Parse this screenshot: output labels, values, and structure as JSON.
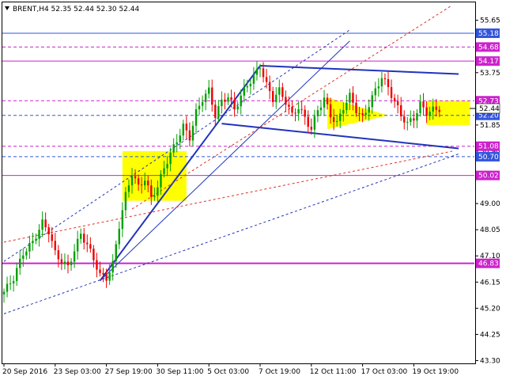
{
  "chart_data": {
    "type": "candlestick",
    "title": "BRENT,H4  52.35 52.44 52.30 52.44",
    "symbol": "BRENT",
    "timeframe": "H4",
    "last_bar": {
      "open": 52.35,
      "high": 52.44,
      "low": 52.3,
      "close": 52.44
    },
    "current_price_label": "52.44",
    "ylim": [
      43.2,
      56.3
    ],
    "y_ticks": [
      "55.65",
      "54.68",
      "53.75",
      "52.80",
      "51.85",
      "50.90",
      "50.02",
      "49.00",
      "48.05",
      "47.10",
      "46.15",
      "45.20",
      "44.25",
      "43.30"
    ],
    "x_ticks": [
      "20 Sep 2016",
      "23 Sep 03:00",
      "27 Sep 19:00",
      "30 Sep 11:00",
      "5 Oct 03:00",
      "7 Oct 19:00",
      "12 Oct 11:00",
      "17 Oct 03:00",
      "19 Oct 19:00"
    ],
    "x_tick_index": [
      0,
      16,
      32,
      48,
      64,
      80,
      96,
      112,
      128
    ],
    "bar_count": 142,
    "level_labels": [
      {
        "text": "55.18",
        "price": 55.18,
        "color": "#3355dd"
      },
      {
        "text": "54.68",
        "price": 54.68,
        "color": "#cc22cc"
      },
      {
        "text": "54.17",
        "price": 54.17,
        "color": "#cc22cc"
      },
      {
        "text": "52.73",
        "price": 52.73,
        "color": "#cc22cc"
      },
      {
        "text": "52.20",
        "price": 52.2,
        "color": "#3355dd"
      },
      {
        "text": "51.08",
        "price": 51.08,
        "color": "#cc22cc"
      },
      {
        "text": "50.70",
        "price": 50.7,
        "color": "#3355dd"
      },
      {
        "text": "50.02",
        "price": 50.02,
        "color": "#cc22cc"
      },
      {
        "text": "46.83",
        "price": 46.83,
        "color": "#cc22cc"
      }
    ],
    "close_path": [
      [
        0,
        45.8
      ],
      [
        3,
        46.3
      ],
      [
        6,
        47.2
      ],
      [
        9,
        47.6
      ],
      [
        12,
        48.3
      ],
      [
        14,
        48.0
      ],
      [
        16,
        47.2
      ],
      [
        18,
        46.9
      ],
      [
        20,
        46.7
      ],
      [
        22,
        47.3
      ],
      [
        24,
        47.9
      ],
      [
        26,
        47.5
      ],
      [
        28,
        47.0
      ],
      [
        30,
        46.4
      ],
      [
        32,
        46.3
      ],
      [
        34,
        46.8
      ],
      [
        36,
        48.2
      ],
      [
        38,
        49.3
      ],
      [
        40,
        50.1
      ],
      [
        42,
        49.6
      ],
      [
        44,
        49.9
      ],
      [
        46,
        49.2
      ],
      [
        48,
        49.6
      ],
      [
        50,
        50.3
      ],
      [
        52,
        50.8
      ],
      [
        54,
        51.3
      ],
      [
        56,
        51.8
      ],
      [
        58,
        51.4
      ],
      [
        60,
        52.3
      ],
      [
        62,
        52.8
      ],
      [
        64,
        53.1
      ],
      [
        66,
        52.2
      ],
      [
        68,
        52.7
      ],
      [
        70,
        52.9
      ],
      [
        72,
        52.4
      ],
      [
        74,
        52.9
      ],
      [
        76,
        53.3
      ],
      [
        78,
        53.6
      ],
      [
        80,
        54.0
      ],
      [
        82,
        53.3
      ],
      [
        84,
        52.8
      ],
      [
        86,
        53.1
      ],
      [
        88,
        52.7
      ],
      [
        90,
        52.2
      ],
      [
        92,
        52.5
      ],
      [
        94,
        52.1
      ],
      [
        96,
        51.7
      ],
      [
        98,
        52.4
      ],
      [
        100,
        52.8
      ],
      [
        102,
        52.2
      ],
      [
        104,
        51.9
      ],
      [
        106,
        52.5
      ],
      [
        108,
        52.9
      ],
      [
        110,
        52.4
      ],
      [
        112,
        52.1
      ],
      [
        114,
        52.6
      ],
      [
        116,
        53.1
      ],
      [
        118,
        53.6
      ],
      [
        120,
        53.2
      ],
      [
        122,
        52.7
      ],
      [
        124,
        52.2
      ],
      [
        126,
        51.9
      ],
      [
        128,
        52.1
      ],
      [
        130,
        52.6
      ],
      [
        132,
        52.3
      ],
      [
        134,
        52.4
      ],
      [
        136,
        52.44
      ]
    ]
  }
}
